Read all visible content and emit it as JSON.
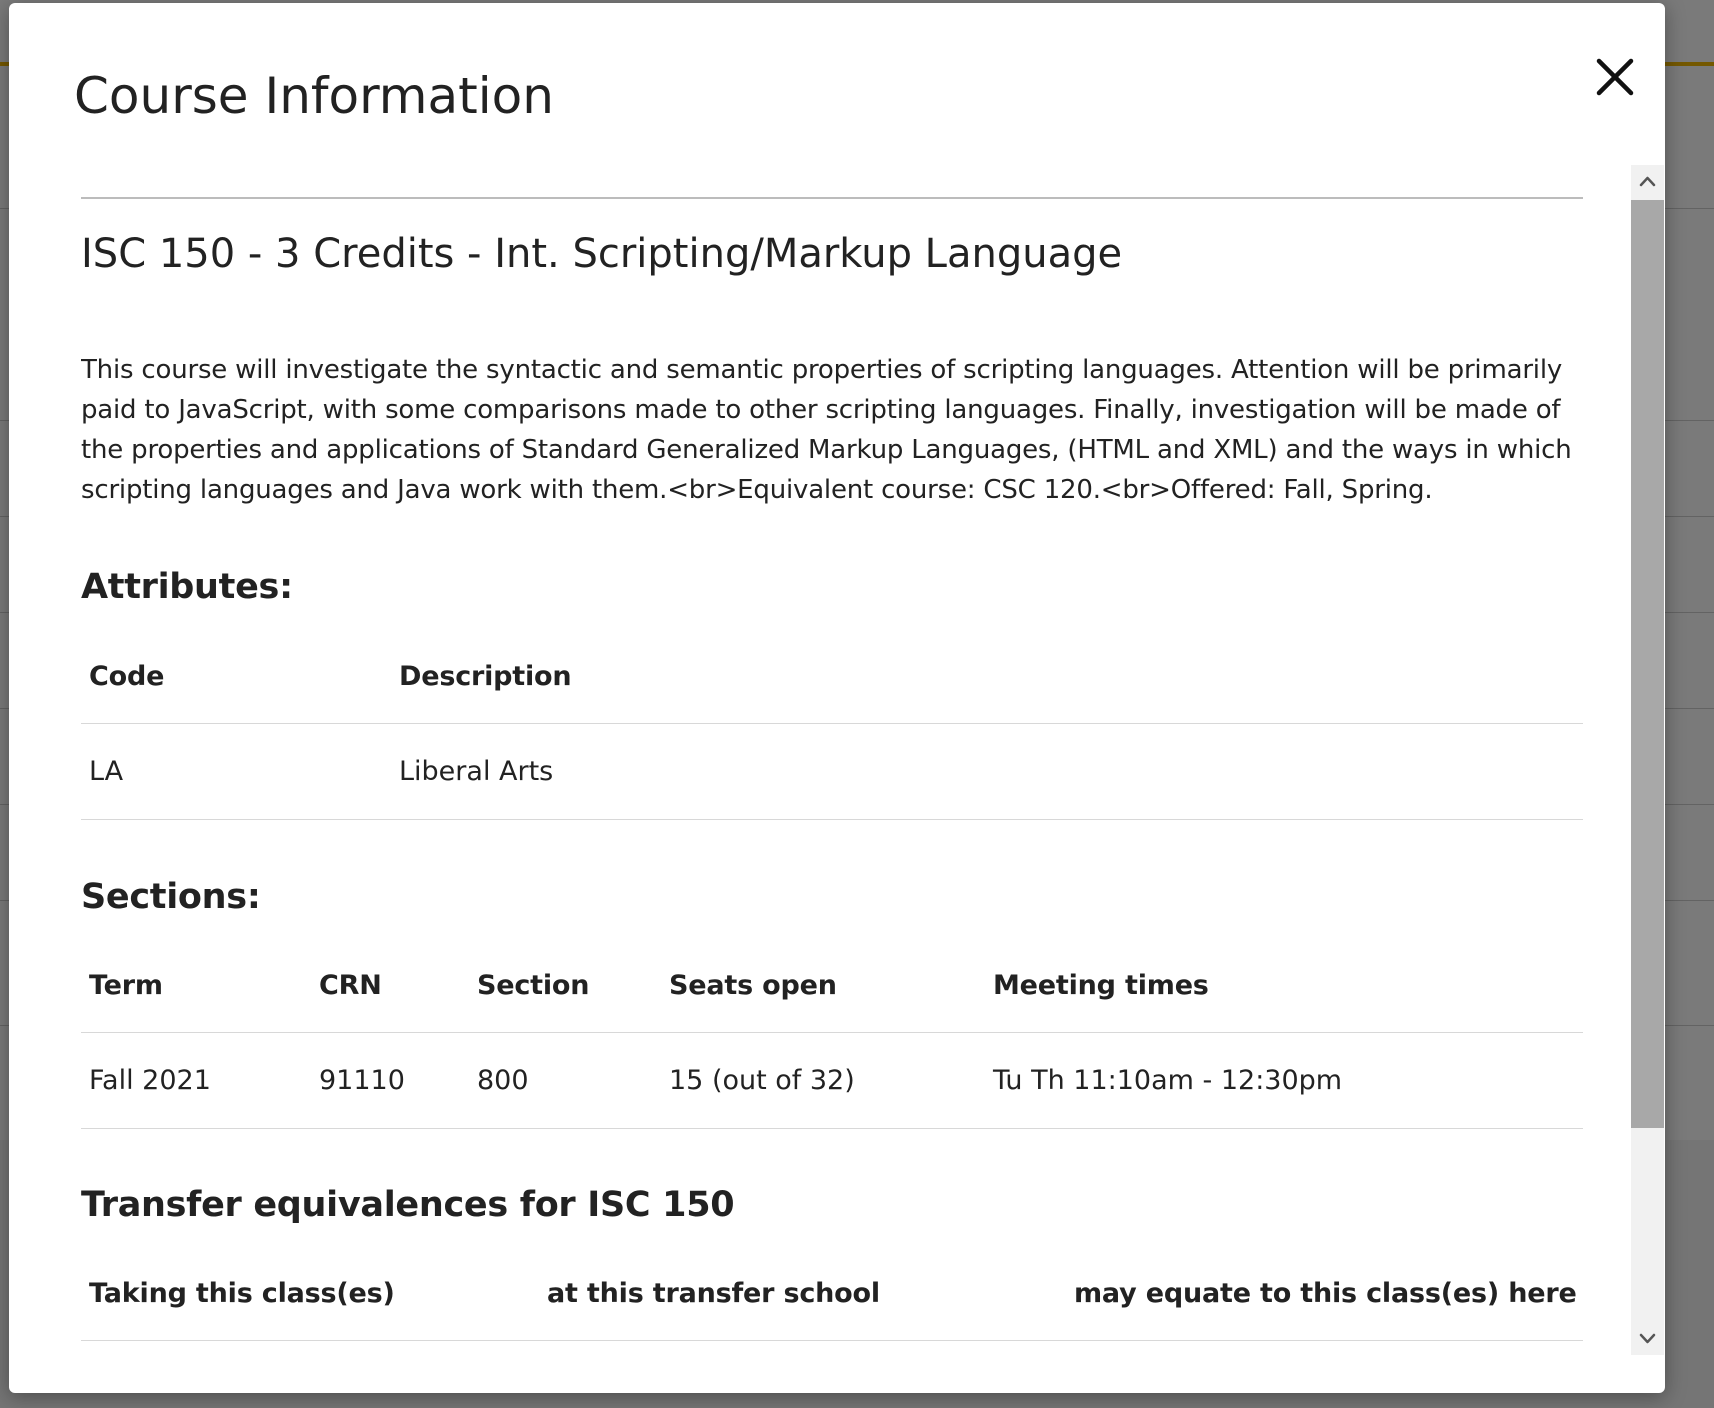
{
  "modal": {
    "title": "Course Information",
    "close_icon": "close-icon"
  },
  "course": {
    "heading": "ISC 150 - 3 Credits - Int. Scripting/Markup Language",
    "description": "This course will investigate the syntactic and semantic properties of scripting languages. Attention will be primarily paid to JavaScript, with some comparisons made to other scripting languages. Finally, investigation will be made of the properties and applications of Standard Generalized Markup Languages, (HTML and XML) and the ways in which scripting languages and Java work with them.<br>Equivalent course: CSC 120.<br>Offered: Fall, Spring."
  },
  "attributes": {
    "heading": "Attributes:",
    "columns": [
      "Code",
      "Description"
    ],
    "rows": [
      [
        "LA",
        "Liberal Arts"
      ]
    ]
  },
  "sections": {
    "heading": "Sections:",
    "columns": [
      "Term",
      "CRN",
      "Section",
      "Seats open",
      "Meeting times"
    ],
    "rows": [
      [
        "Fall 2021",
        "91110",
        "800",
        "15 (out of 32)",
        "Tu Th 11:10am - 12:30pm"
      ]
    ]
  },
  "transfer": {
    "heading": "Transfer equivalences for ISC 150",
    "columns": [
      "Taking this class(es)",
      "at this transfer school",
      "may equate to this class(es) here"
    ]
  },
  "scrollbar": {
    "up_icon": "chevron-up-icon",
    "down_icon": "chevron-down-icon"
  },
  "colors": {
    "accent": "#f2b800",
    "thumb": "#a8a8a8",
    "track": "#f1f1f1"
  }
}
